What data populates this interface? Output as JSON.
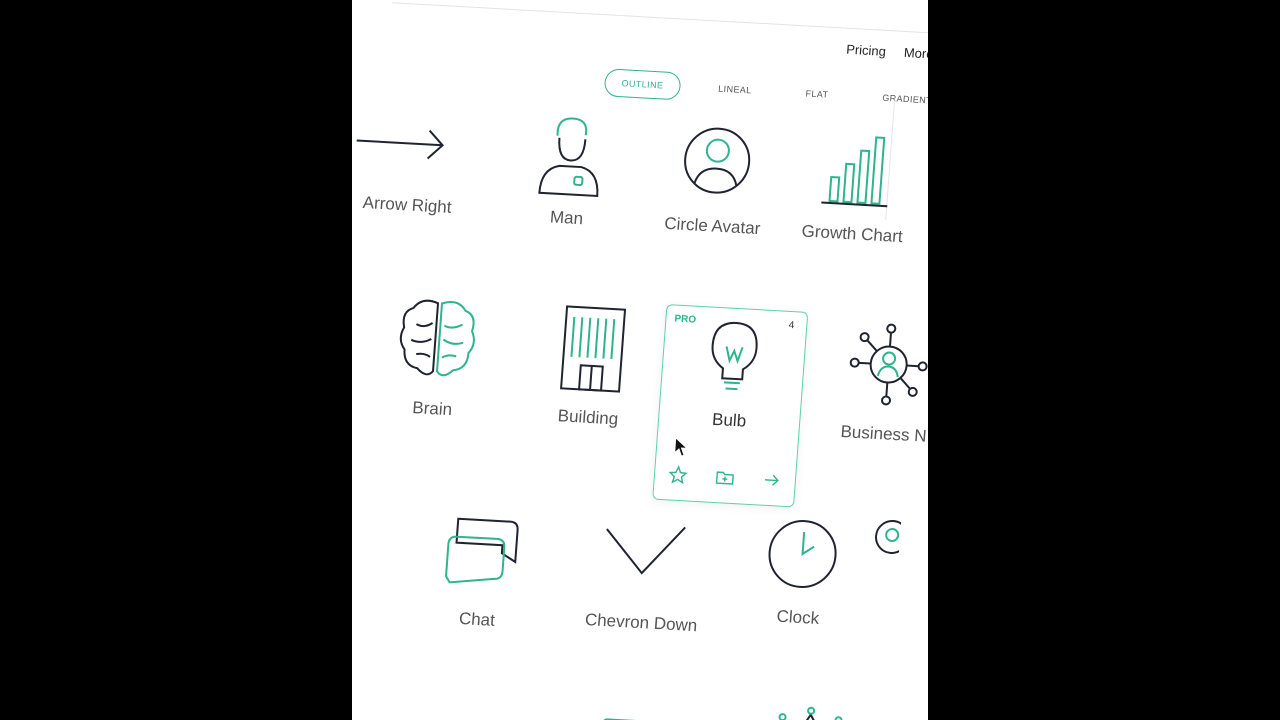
{
  "nav": {
    "pricing": "Pricing",
    "more": "More"
  },
  "style_tabs": [
    {
      "label": "OUTLINE",
      "active": true
    },
    {
      "label": "LINEAL",
      "active": false
    },
    {
      "label": "FLAT",
      "active": false
    },
    {
      "label": "GRADIENT",
      "active": false
    }
  ],
  "colors": {
    "accent": "#2fb48e",
    "stroke": "#1f2430",
    "background": "#ffffff"
  },
  "icons": [
    {
      "name": "arrow-right-icon",
      "label": "Arrow Right"
    },
    {
      "name": "man-icon",
      "label": "Man"
    },
    {
      "name": "circle-avatar-icon",
      "label": "Circle Avatar"
    },
    {
      "name": "growth-chart-icon",
      "label": "Growth Chart"
    },
    {
      "name": "brain-icon",
      "label": "Brain"
    },
    {
      "name": "building-icon",
      "label": "Building"
    },
    {
      "name": "bulb-icon",
      "label": "Bulb",
      "badge": "PRO",
      "count": "4",
      "selected": true
    },
    {
      "name": "business-network-icon",
      "label": "Business N"
    },
    {
      "name": "chat-icon",
      "label": "Chat"
    },
    {
      "name": "chevron-down-icon",
      "label": "Chevron Down"
    },
    {
      "name": "clock-icon",
      "label": "Clock"
    }
  ],
  "card_actions": [
    "star-icon",
    "folder-icon",
    "arrow-right-icon"
  ]
}
